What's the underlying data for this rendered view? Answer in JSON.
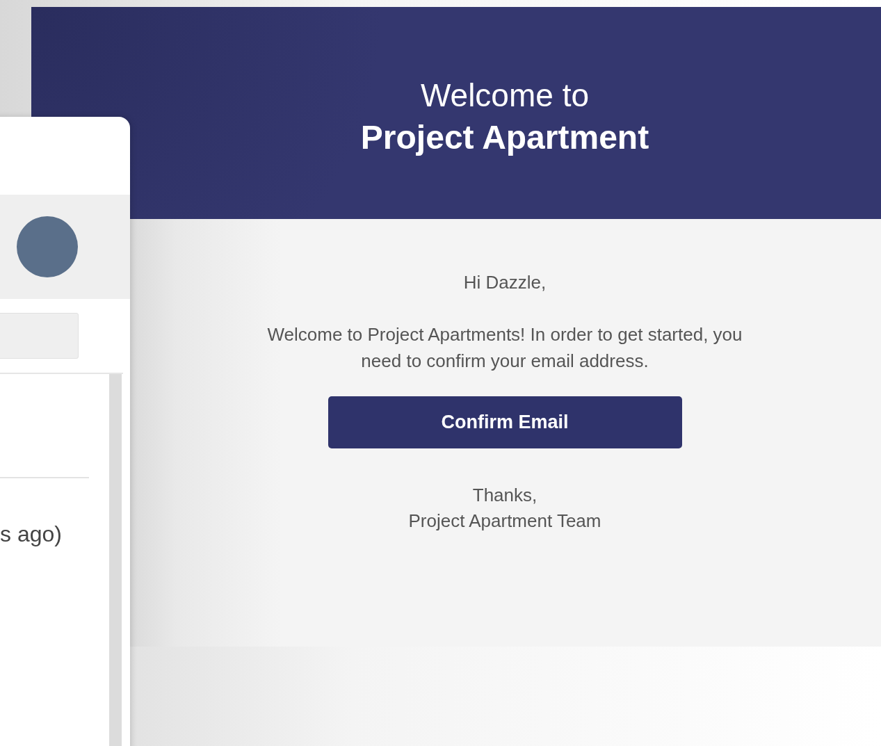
{
  "email": {
    "heading_line1": "Welcome to",
    "heading_line2": "Project Apartment",
    "greeting": "Hi Dazzle,",
    "body": "Welcome to Project Apartments! In order to get started, you need to confirm your email address.",
    "button": "Confirm Email",
    "signoff": "Thanks,",
    "signature": "Project Apartment Team"
  },
  "side_card": {
    "time_text": "s ago)"
  }
}
